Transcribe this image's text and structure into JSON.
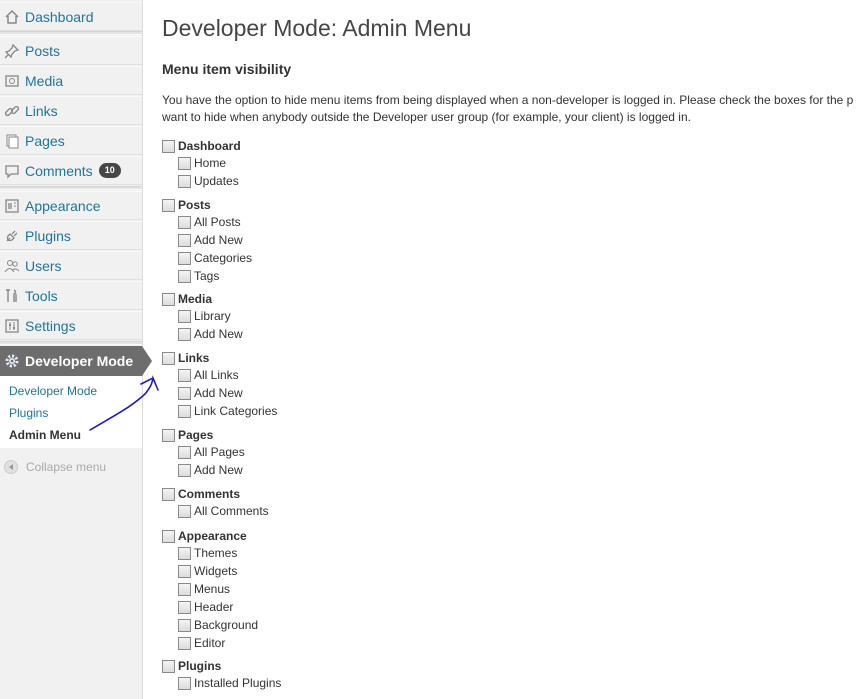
{
  "sidebar": {
    "items": [
      {
        "label": "Dashboard",
        "icon": "dashboard-icon"
      },
      {
        "label": "Posts",
        "icon": "pushpin-icon"
      },
      {
        "label": "Media",
        "icon": "media-icon"
      },
      {
        "label": "Links",
        "icon": "link-icon"
      },
      {
        "label": "Pages",
        "icon": "pages-icon"
      },
      {
        "label": "Comments",
        "icon": "comment-icon",
        "badge": "10"
      },
      {
        "label": "Appearance",
        "icon": "appearance-icon"
      },
      {
        "label": "Plugins",
        "icon": "plugin-icon"
      },
      {
        "label": "Users",
        "icon": "users-icon"
      },
      {
        "label": "Tools",
        "icon": "tools-icon"
      },
      {
        "label": "Settings",
        "icon": "settings-icon"
      }
    ],
    "developer": {
      "label": "Developer Mode",
      "icon": "gear-icon"
    },
    "submenu": [
      "Developer Mode",
      "Plugins",
      "Admin Menu"
    ],
    "collapse_label": "Collapse menu"
  },
  "main": {
    "title": "Developer Mode: Admin Menu",
    "section_title": "Menu item visibility",
    "intro_line1": "You have the option to hide menu items from being displayed when a non-developer is logged in. Please check the boxes for the p",
    "intro_line2": "want to hide when anybody outside the Developer user group (for example, your client) is logged in.",
    "groups": [
      {
        "label": "Dashboard",
        "children": [
          "Home",
          "Updates"
        ]
      },
      {
        "label": "Posts",
        "children": [
          "All Posts",
          "Add New",
          "Categories",
          "Tags"
        ]
      },
      {
        "label": "Media",
        "children": [
          "Library",
          "Add New"
        ]
      },
      {
        "label": "Links",
        "children": [
          "All Links",
          "Add New",
          "Link Categories"
        ]
      },
      {
        "label": "Pages",
        "children": [
          "All Pages",
          "Add New"
        ]
      },
      {
        "label": "Comments",
        "children": [
          "All Comments"
        ]
      },
      {
        "label": "Appearance",
        "children": [
          "Themes",
          "Widgets",
          "Menus",
          "Header",
          "Background",
          "Editor"
        ]
      },
      {
        "label": "Plugins",
        "children": [
          "Installed Plugins"
        ]
      }
    ]
  },
  "colors": {
    "link": "#21759b",
    "active_menu": "#6d6d6d",
    "annotation": "#1a1ad6"
  }
}
